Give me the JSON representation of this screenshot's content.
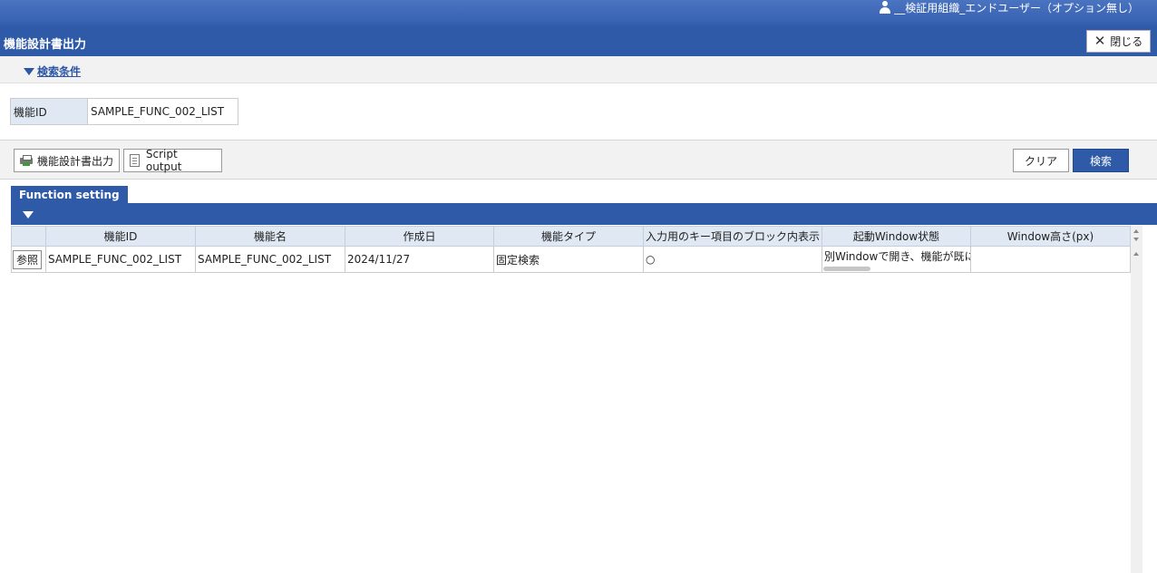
{
  "header": {
    "user_name": "__検証用組織_エンドユーザー（オプション無し）",
    "page_title": "機能設計書出力",
    "close_label": "閉じる"
  },
  "search": {
    "toggle_label": "検索条件",
    "function_id_label": "機能ID",
    "function_id_value": "SAMPLE_FUNC_002_LIST"
  },
  "toolbar": {
    "design_output_label": "機能設計書出力",
    "script_output_label": "Script output",
    "clear_label": "クリア",
    "search_label": "検索"
  },
  "section": {
    "tab_label": "Function setting"
  },
  "table": {
    "columns": [
      "",
      "機能ID",
      "機能名",
      "作成日",
      "機能タイプ",
      "入力用のキー項目のブロック内表示",
      "起動Window状態",
      "Window高さ(px)"
    ],
    "rows": [
      {
        "ref_label": "参照",
        "function_id": "SAMPLE_FUNC_002_LIST",
        "function_name": "SAMPLE_FUNC_002_LIST",
        "created": "2024/11/27",
        "type": "固定検索",
        "key_display": "○",
        "window_state": "別Windowで開き、機能が既に",
        "window_height": ""
      }
    ]
  },
  "colors": {
    "brand_blue": "#2f5aa8",
    "header_cell": "#dfe8f3",
    "toolbar_bg": "#f2f2f2"
  },
  "icons": [
    "user-icon",
    "close-icon",
    "collapse-triangle-icon",
    "printer-icon",
    "document-icon",
    "scroll-up-icon",
    "scroll-down-icon"
  ]
}
